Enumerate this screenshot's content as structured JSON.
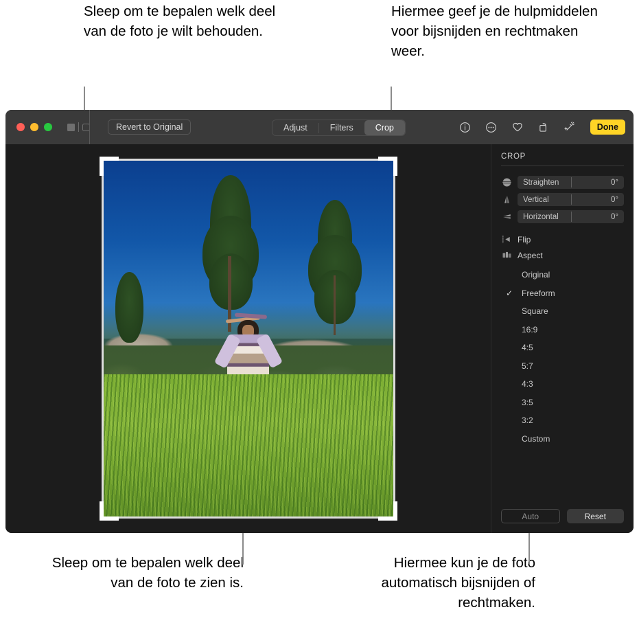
{
  "callouts": {
    "top_left": "Sleep om te bepalen welk deel van de foto je wilt behouden.",
    "top_right": "Hiermee geef je de hulpmiddelen voor bijsnijden en rechtmaken weer.",
    "bottom_left": "Sleep om te bepalen welk deel van de foto te zien is.",
    "bottom_right": "Hiermee kun je de foto automatisch bijsnijden of rechtmaken."
  },
  "window": {
    "toolbar": {
      "revert_label": "Revert to Original",
      "segments": [
        {
          "label": "Adjust",
          "active": false
        },
        {
          "label": "Filters",
          "active": false
        },
        {
          "label": "Crop",
          "active": true
        }
      ],
      "icons": [
        {
          "name": "info-icon"
        },
        {
          "name": "more-options-icon"
        },
        {
          "name": "favorite-heart-icon"
        },
        {
          "name": "rotate-icon"
        },
        {
          "name": "enhance-magic-wand-icon"
        }
      ],
      "done_label": "Done",
      "traffic_lights": [
        "close",
        "minimize",
        "zoom"
      ],
      "accent_color": "#ffd426"
    },
    "panel": {
      "title": "CROP",
      "sliders": [
        {
          "icon": "straighten-icon",
          "label": "Straighten",
          "value": "0°"
        },
        {
          "icon": "vertical-perspective-icon",
          "label": "Vertical",
          "value": "0°"
        },
        {
          "icon": "horizontal-perspective-icon",
          "label": "Horizontal",
          "value": "0°"
        }
      ],
      "menus": [
        {
          "icon": "flip-icon",
          "label": "Flip"
        },
        {
          "icon": "aspect-icon",
          "label": "Aspect"
        }
      ],
      "aspect_options": [
        {
          "label": "Original",
          "selected": false
        },
        {
          "label": "Freeform",
          "selected": true
        },
        {
          "label": "Square",
          "selected": false
        },
        {
          "label": "16:9",
          "selected": false
        },
        {
          "label": "4:5",
          "selected": false
        },
        {
          "label": "5:7",
          "selected": false
        },
        {
          "label": "4:3",
          "selected": false
        },
        {
          "label": "3:5",
          "selected": false
        },
        {
          "label": "3:2",
          "selected": false
        },
        {
          "label": "Custom",
          "selected": false
        }
      ],
      "check_glyph": "✓",
      "footer": {
        "auto_label": "Auto",
        "reset_label": "Reset"
      }
    },
    "canvas": {
      "photo_alt": "Person standing in a tall green meadow with pine trees, rocky ridge and blue sky",
      "crop_handles": [
        "top-left",
        "top-right",
        "bottom-left",
        "bottom-right"
      ]
    }
  }
}
